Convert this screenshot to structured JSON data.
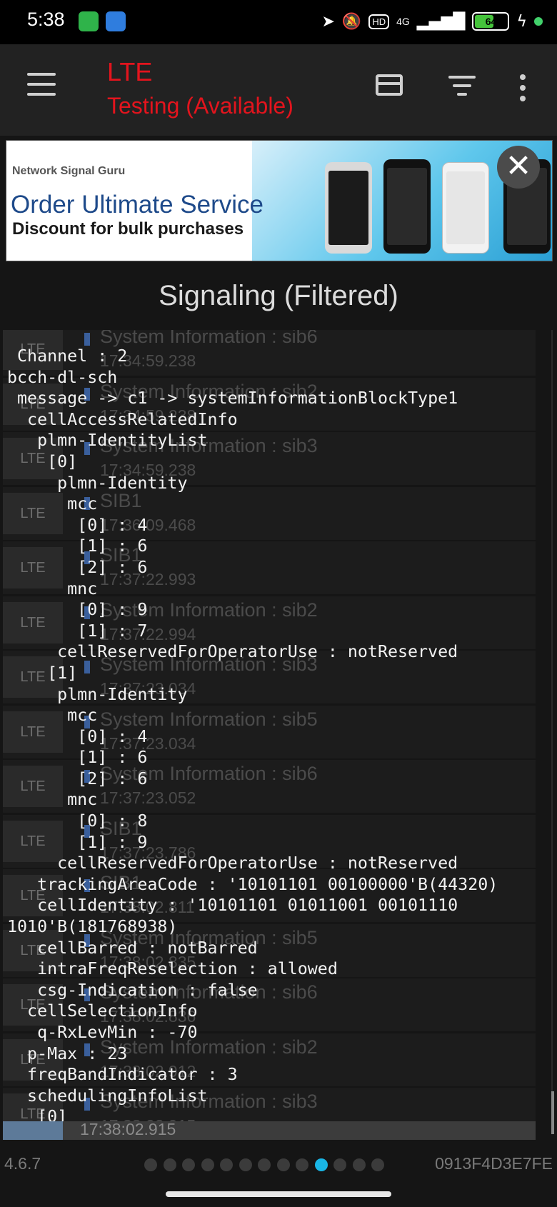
{
  "status_bar": {
    "time": "5:38",
    "network_type": "4G",
    "hd_label": "HD",
    "battery_percent": "64",
    "battery_level": 0.64,
    "icons": [
      "location-arrow-icon",
      "bell-muted-icon",
      "hd-icon",
      "signal-icon",
      "battery-icon",
      "charging-icon",
      "active-dot-icon"
    ]
  },
  "app_bar": {
    "title": "LTE",
    "subtitle": "Testing (Available)",
    "title_color": "#e3141d",
    "icons": [
      "menu-icon",
      "card-icon",
      "filter-icon",
      "more-vertical-icon"
    ]
  },
  "banner": {
    "brand": "Network Signal Guru",
    "headline": "Order Ultimate Service",
    "subline": "Discount for bulk purchases"
  },
  "section_title": "Signaling (Filtered)",
  "background_list": [
    {
      "badge": "LTE",
      "title": "System Information : sib6",
      "time": "17:34:59.238"
    },
    {
      "badge": "LTE",
      "title": "System Information : sib2",
      "time": "17:34:59.238"
    },
    {
      "badge": "LTE",
      "title": "System Information : sib3",
      "time": "17:34:59.238"
    },
    {
      "badge": "LTE",
      "title": "SIB1",
      "time": "17:36:09.468"
    },
    {
      "badge": "LTE",
      "title": "SIB1",
      "time": "17:37:22.993"
    },
    {
      "badge": "LTE",
      "title": "System Information : sib2",
      "time": "17:37:22.994"
    },
    {
      "badge": "LTE",
      "title": "System Information : sib3",
      "time": "17:37:23.034"
    },
    {
      "badge": "LTE",
      "title": "System Information : sib5",
      "time": "17:37:23.034"
    },
    {
      "badge": "LTE",
      "title": "System Information : sib6",
      "time": "17:37:23.052"
    },
    {
      "badge": "LTE",
      "title": "SIB1",
      "time": "17:37:23.786"
    },
    {
      "badge": "LTE",
      "title": "SIB1",
      "time": "17:38:02.811"
    },
    {
      "badge": "LTE",
      "title": "System Information : sib5",
      "time": "17:38:02.835"
    },
    {
      "badge": "LTE",
      "title": "System Information : sib6",
      "time": "17:38:02.836"
    },
    {
      "badge": "LTE",
      "title": "System Information : sib2",
      "time": "17:38:02.912"
    },
    {
      "badge": "LTE",
      "title": "System Information : sib3",
      "time": "17:38:02.915"
    }
  ],
  "detail_lines": [
    " Channel : 2",
    "bcch-dl-sch",
    " message -> c1 -> systemInformationBlockType1",
    "  cellAccessRelatedInfo",
    "   plmn-IdentityList",
    "    [0]",
    "     plmn-Identity",
    "      mcc",
    "       [0] : 4",
    "       [1] : 6",
    "       [2] : 6",
    "      mnc",
    "       [0] : 9",
    "       [1] : 7",
    "     cellReservedForOperatorUse : notReserved",
    "    [1]",
    "     plmn-Identity",
    "      mcc",
    "       [0] : 4",
    "       [1] : 6",
    "       [2] : 6",
    "      mnc",
    "       [0] : 8",
    "       [1] : 9",
    "     cellReservedForOperatorUse : notReserved",
    "   trackingAreaCode : '10101101 00100000'B(44320)",
    "   cellIdentity : '10101101 01011001 00101110",
    "1010'B(181768938)",
    "   cellBarred : notBarred",
    "   intraFreqReselection : allowed",
    "   csg-Indication : false",
    "  cellSelectionInfo",
    "   q-RxLevMin : -70",
    "  p-Max : 23",
    "  freqBandIndicator : 3",
    "  schedulingInfoList",
    "   [0]"
  ],
  "bottom_time": "17:38:02.915",
  "footer": {
    "version": "4.6.7",
    "device_id": "0913F4D3E7FE",
    "page_count": 13,
    "active_page": 10,
    "active_color": "#19b6e6"
  }
}
